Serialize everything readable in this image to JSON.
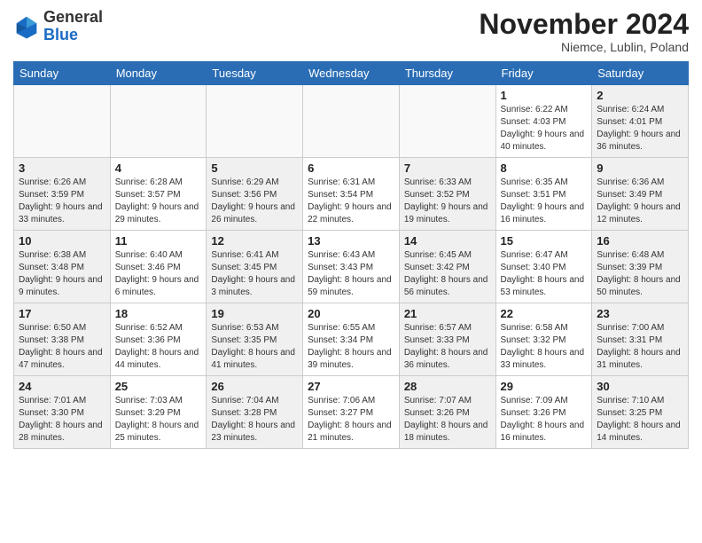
{
  "header": {
    "logo_general": "General",
    "logo_blue": "Blue",
    "month_title": "November 2024",
    "location": "Niemce, Lublin, Poland"
  },
  "weekdays": [
    "Sunday",
    "Monday",
    "Tuesday",
    "Wednesday",
    "Thursday",
    "Friday",
    "Saturday"
  ],
  "weeks": [
    [
      {
        "day": "",
        "info": ""
      },
      {
        "day": "",
        "info": ""
      },
      {
        "day": "",
        "info": ""
      },
      {
        "day": "",
        "info": ""
      },
      {
        "day": "",
        "info": ""
      },
      {
        "day": "1",
        "info": "Sunrise: 6:22 AM\nSunset: 4:03 PM\nDaylight: 9 hours and 40 minutes."
      },
      {
        "day": "2",
        "info": "Sunrise: 6:24 AM\nSunset: 4:01 PM\nDaylight: 9 hours and 36 minutes."
      }
    ],
    [
      {
        "day": "3",
        "info": "Sunrise: 6:26 AM\nSunset: 3:59 PM\nDaylight: 9 hours and 33 minutes."
      },
      {
        "day": "4",
        "info": "Sunrise: 6:28 AM\nSunset: 3:57 PM\nDaylight: 9 hours and 29 minutes."
      },
      {
        "day": "5",
        "info": "Sunrise: 6:29 AM\nSunset: 3:56 PM\nDaylight: 9 hours and 26 minutes."
      },
      {
        "day": "6",
        "info": "Sunrise: 6:31 AM\nSunset: 3:54 PM\nDaylight: 9 hours and 22 minutes."
      },
      {
        "day": "7",
        "info": "Sunrise: 6:33 AM\nSunset: 3:52 PM\nDaylight: 9 hours and 19 minutes."
      },
      {
        "day": "8",
        "info": "Sunrise: 6:35 AM\nSunset: 3:51 PM\nDaylight: 9 hours and 16 minutes."
      },
      {
        "day": "9",
        "info": "Sunrise: 6:36 AM\nSunset: 3:49 PM\nDaylight: 9 hours and 12 minutes."
      }
    ],
    [
      {
        "day": "10",
        "info": "Sunrise: 6:38 AM\nSunset: 3:48 PM\nDaylight: 9 hours and 9 minutes."
      },
      {
        "day": "11",
        "info": "Sunrise: 6:40 AM\nSunset: 3:46 PM\nDaylight: 9 hours and 6 minutes."
      },
      {
        "day": "12",
        "info": "Sunrise: 6:41 AM\nSunset: 3:45 PM\nDaylight: 9 hours and 3 minutes."
      },
      {
        "day": "13",
        "info": "Sunrise: 6:43 AM\nSunset: 3:43 PM\nDaylight: 8 hours and 59 minutes."
      },
      {
        "day": "14",
        "info": "Sunrise: 6:45 AM\nSunset: 3:42 PM\nDaylight: 8 hours and 56 minutes."
      },
      {
        "day": "15",
        "info": "Sunrise: 6:47 AM\nSunset: 3:40 PM\nDaylight: 8 hours and 53 minutes."
      },
      {
        "day": "16",
        "info": "Sunrise: 6:48 AM\nSunset: 3:39 PM\nDaylight: 8 hours and 50 minutes."
      }
    ],
    [
      {
        "day": "17",
        "info": "Sunrise: 6:50 AM\nSunset: 3:38 PM\nDaylight: 8 hours and 47 minutes."
      },
      {
        "day": "18",
        "info": "Sunrise: 6:52 AM\nSunset: 3:36 PM\nDaylight: 8 hours and 44 minutes."
      },
      {
        "day": "19",
        "info": "Sunrise: 6:53 AM\nSunset: 3:35 PM\nDaylight: 8 hours and 41 minutes."
      },
      {
        "day": "20",
        "info": "Sunrise: 6:55 AM\nSunset: 3:34 PM\nDaylight: 8 hours and 39 minutes."
      },
      {
        "day": "21",
        "info": "Sunrise: 6:57 AM\nSunset: 3:33 PM\nDaylight: 8 hours and 36 minutes."
      },
      {
        "day": "22",
        "info": "Sunrise: 6:58 AM\nSunset: 3:32 PM\nDaylight: 8 hours and 33 minutes."
      },
      {
        "day": "23",
        "info": "Sunrise: 7:00 AM\nSunset: 3:31 PM\nDaylight: 8 hours and 31 minutes."
      }
    ],
    [
      {
        "day": "24",
        "info": "Sunrise: 7:01 AM\nSunset: 3:30 PM\nDaylight: 8 hours and 28 minutes."
      },
      {
        "day": "25",
        "info": "Sunrise: 7:03 AM\nSunset: 3:29 PM\nDaylight: 8 hours and 25 minutes."
      },
      {
        "day": "26",
        "info": "Sunrise: 7:04 AM\nSunset: 3:28 PM\nDaylight: 8 hours and 23 minutes."
      },
      {
        "day": "27",
        "info": "Sunrise: 7:06 AM\nSunset: 3:27 PM\nDaylight: 8 hours and 21 minutes."
      },
      {
        "day": "28",
        "info": "Sunrise: 7:07 AM\nSunset: 3:26 PM\nDaylight: 8 hours and 18 minutes."
      },
      {
        "day": "29",
        "info": "Sunrise: 7:09 AM\nSunset: 3:26 PM\nDaylight: 8 hours and 16 minutes."
      },
      {
        "day": "30",
        "info": "Sunrise: 7:10 AM\nSunset: 3:25 PM\nDaylight: 8 hours and 14 minutes."
      }
    ]
  ]
}
